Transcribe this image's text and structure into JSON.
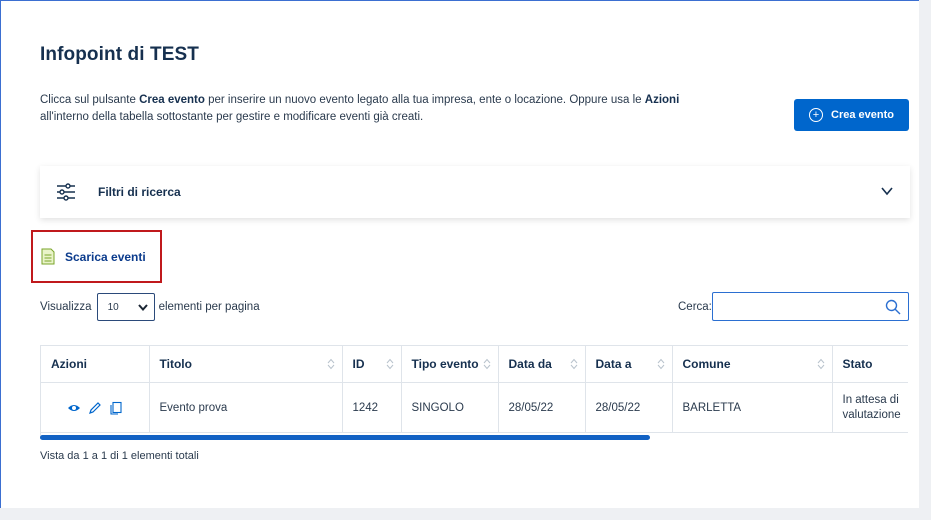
{
  "page": {
    "title": "Infopoint di TEST",
    "intro": {
      "part1": "Clicca sul pulsante ",
      "bold1": "Crea evento",
      "part2": " per inserire un nuovo evento legato alla tua impresa, ente o locazione. Oppure usa le ",
      "bold2": "Azioni",
      "part3": " all'interno della tabella sottostante per gestire e modificare eventi già creati."
    },
    "create_button": {
      "label": "Crea evento",
      "icon": "plus-circle-icon"
    }
  },
  "filters": {
    "label": "Filtri di ricerca",
    "icon": "sliders-icon",
    "toggle_icon": "chevron-down-icon"
  },
  "download": {
    "label": "Scarica eventi",
    "icon": "spreadsheet-file-icon",
    "highlight_color": "#c0191c"
  },
  "controls": {
    "show_label": "Visualizza",
    "page_size": "10",
    "per_page_label": "elementi per pagina",
    "search_label": "Cerca:",
    "search_value": ""
  },
  "table": {
    "headers": [
      "Azioni",
      "Titolo",
      "ID",
      "Tipo evento",
      "Data da",
      "Data a",
      "Comune",
      "Stato"
    ],
    "rows": [
      {
        "actions": [
          "eye-icon",
          "pencil-icon",
          "copy-icon"
        ],
        "titolo": "Evento prova",
        "id": "1242",
        "tipo": "SINGOLO",
        "data_da": "28/05/22",
        "data_a": "28/05/22",
        "comune": "BARLETTA",
        "stato": "In attesa di valutazione"
      }
    ]
  },
  "footer": {
    "info": "Vista da 1 a 1 di 1 elementi totali"
  },
  "colors": {
    "primary": "#0066cc",
    "title": "#16304f",
    "link": "#0b3b8c"
  }
}
